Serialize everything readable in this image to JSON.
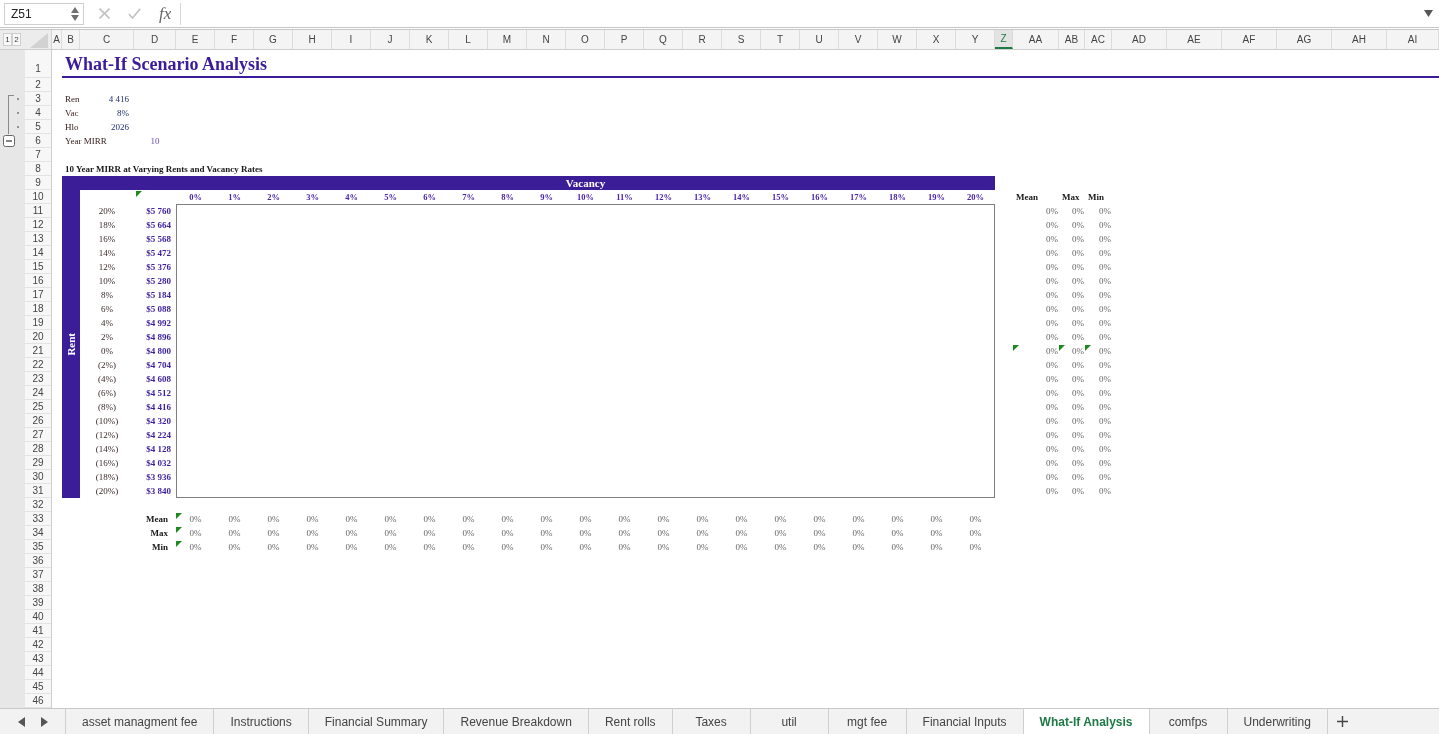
{
  "formula_bar": {
    "name_box": "Z51",
    "function_label": "fx"
  },
  "outline": {
    "levels": [
      "1",
      "2"
    ],
    "group_expanded": true
  },
  "columns": [
    {
      "label": "A",
      "selected": false
    },
    {
      "label": "B",
      "selected": false
    },
    {
      "label": "C",
      "selected": false
    },
    {
      "label": "D",
      "selected": false
    },
    {
      "label": "E",
      "selected": false
    },
    {
      "label": "F",
      "selected": false
    },
    {
      "label": "G",
      "selected": false
    },
    {
      "label": "H",
      "selected": false
    },
    {
      "label": "I",
      "selected": false
    },
    {
      "label": "J",
      "selected": false
    },
    {
      "label": "K",
      "selected": false
    },
    {
      "label": "L",
      "selected": false
    },
    {
      "label": "M",
      "selected": false
    },
    {
      "label": "N",
      "selected": false
    },
    {
      "label": "O",
      "selected": false
    },
    {
      "label": "P",
      "selected": false
    },
    {
      "label": "Q",
      "selected": false
    },
    {
      "label": "R",
      "selected": false
    },
    {
      "label": "S",
      "selected": false
    },
    {
      "label": "T",
      "selected": false
    },
    {
      "label": "U",
      "selected": false
    },
    {
      "label": "V",
      "selected": false
    },
    {
      "label": "W",
      "selected": false
    },
    {
      "label": "X",
      "selected": false
    },
    {
      "label": "Y",
      "selected": false
    },
    {
      "label": "Z",
      "selected": true
    },
    {
      "label": "AA",
      "selected": false
    },
    {
      "label": "AB",
      "selected": false
    },
    {
      "label": "AC",
      "selected": false
    },
    {
      "label": "AD",
      "selected": false
    },
    {
      "label": "AE",
      "selected": false
    },
    {
      "label": "AF",
      "selected": false
    },
    {
      "label": "AG",
      "selected": false
    },
    {
      "label": "AH",
      "selected": false
    },
    {
      "label": "AI",
      "selected": false
    }
  ],
  "row_numbers": [
    "1",
    "2",
    "3",
    "4",
    "5",
    "6",
    "7",
    "8",
    "9",
    "10",
    "11",
    "12",
    "13",
    "14",
    "15",
    "16",
    "17",
    "18",
    "19",
    "20",
    "21",
    "22",
    "23",
    "24",
    "25",
    "26",
    "27",
    "28",
    "29",
    "30",
    "31",
    "32",
    "33",
    "34",
    "35",
    "36",
    "37",
    "38",
    "39",
    "40",
    "41",
    "42",
    "43",
    "44",
    "45",
    "46"
  ],
  "sheet": {
    "title": "What-If Scenario Analysis",
    "inputs": [
      {
        "kind": "value",
        "label": "Ren",
        "value": "4 416"
      },
      {
        "kind": "value",
        "label": "Vac",
        "value": "8%"
      },
      {
        "kind": "value",
        "label": "Hlo",
        "value": "2026"
      },
      {
        "kind": "parameter",
        "label": "Year MIRR",
        "value": "10"
      }
    ],
    "table_title": "10 Year MIRR at Varying Rents and Vacancy Rates",
    "vacancy_label": "Vacancy",
    "rent_label": "Rent",
    "rent_header_flagged": true,
    "vacancy_rates": [
      "0%",
      "1%",
      "2%",
      "3%",
      "4%",
      "5%",
      "6%",
      "7%",
      "8%",
      "9%",
      "10%",
      "11%",
      "12%",
      "13%",
      "14%",
      "15%",
      "16%",
      "17%",
      "18%",
      "19%",
      "20%"
    ],
    "row_summary_headers": [
      "Mean",
      "Max",
      "Min"
    ],
    "rent_rows": [
      {
        "change": "20%",
        "rent": "$5 760",
        "summary": [
          "0%",
          "0%",
          "0%"
        ],
        "flagged": false
      },
      {
        "change": "18%",
        "rent": "$5 664",
        "summary": [
          "0%",
          "0%",
          "0%"
        ],
        "flagged": false
      },
      {
        "change": "16%",
        "rent": "$5 568",
        "summary": [
          "0%",
          "0%",
          "0%"
        ],
        "flagged": false
      },
      {
        "change": "14%",
        "rent": "$5 472",
        "summary": [
          "0%",
          "0%",
          "0%"
        ],
        "flagged": false
      },
      {
        "change": "12%",
        "rent": "$5 376",
        "summary": [
          "0%",
          "0%",
          "0%"
        ],
        "flagged": false
      },
      {
        "change": "10%",
        "rent": "$5 280",
        "summary": [
          "0%",
          "0%",
          "0%"
        ],
        "flagged": false
      },
      {
        "change": "8%",
        "rent": "$5 184",
        "summary": [
          "0%",
          "0%",
          "0%"
        ],
        "flagged": false
      },
      {
        "change": "6%",
        "rent": "$5 088",
        "summary": [
          "0%",
          "0%",
          "0%"
        ],
        "flagged": false
      },
      {
        "change": "4%",
        "rent": "$4 992",
        "summary": [
          "0%",
          "0%",
          "0%"
        ],
        "flagged": false
      },
      {
        "change": "2%",
        "rent": "$4 896",
        "summary": [
          "0%",
          "0%",
          "0%"
        ],
        "flagged": false
      },
      {
        "change": "0%",
        "rent": "$4 800",
        "summary": [
          "0%",
          "0%",
          "0%"
        ],
        "flagged": true
      },
      {
        "change": "(2%)",
        "rent": "$4 704",
        "summary": [
          "0%",
          "0%",
          "0%"
        ],
        "flagged": false
      },
      {
        "change": "(4%)",
        "rent": "$4 608",
        "summary": [
          "0%",
          "0%",
          "0%"
        ],
        "flagged": false
      },
      {
        "change": "(6%)",
        "rent": "$4 512",
        "summary": [
          "0%",
          "0%",
          "0%"
        ],
        "flagged": false
      },
      {
        "change": "(8%)",
        "rent": "$4 416",
        "summary": [
          "0%",
          "0%",
          "0%"
        ],
        "flagged": false
      },
      {
        "change": "(10%)",
        "rent": "$4 320",
        "summary": [
          "0%",
          "0%",
          "0%"
        ],
        "flagged": false
      },
      {
        "change": "(12%)",
        "rent": "$4 224",
        "summary": [
          "0%",
          "0%",
          "0%"
        ],
        "flagged": false
      },
      {
        "change": "(14%)",
        "rent": "$4 128",
        "summary": [
          "0%",
          "0%",
          "0%"
        ],
        "flagged": false
      },
      {
        "change": "(16%)",
        "rent": "$4 032",
        "summary": [
          "0%",
          "0%",
          "0%"
        ],
        "flagged": false
      },
      {
        "change": "(18%)",
        "rent": "$3 936",
        "summary": [
          "0%",
          "0%",
          "0%"
        ],
        "flagged": false
      },
      {
        "change": "(20%)",
        "rent": "$3 840",
        "summary": [
          "0%",
          "0%",
          "0%"
        ],
        "flagged": false
      }
    ],
    "column_summaries": [
      {
        "label": "Mean",
        "flagged": true,
        "values": [
          "0%",
          "0%",
          "0%",
          "0%",
          "0%",
          "0%",
          "0%",
          "0%",
          "0%",
          "0%",
          "0%",
          "0%",
          "0%",
          "0%",
          "0%",
          "0%",
          "0%",
          "0%",
          "0%",
          "0%",
          "0%"
        ]
      },
      {
        "label": "Max",
        "flagged": true,
        "values": [
          "0%",
          "0%",
          "0%",
          "0%",
          "0%",
          "0%",
          "0%",
          "0%",
          "0%",
          "0%",
          "0%",
          "0%",
          "0%",
          "0%",
          "0%",
          "0%",
          "0%",
          "0%",
          "0%",
          "0%",
          "0%"
        ]
      },
      {
        "label": "Min",
        "flagged": true,
        "values": [
          "0%",
          "0%",
          "0%",
          "0%",
          "0%",
          "0%",
          "0%",
          "0%",
          "0%",
          "0%",
          "0%",
          "0%",
          "0%",
          "0%",
          "0%",
          "0%",
          "0%",
          "0%",
          "0%",
          "0%",
          "0%"
        ]
      }
    ]
  },
  "sheet_tabs": [
    {
      "label": "asset managment fee",
      "selected": false
    },
    {
      "label": "Instructions",
      "selected": false
    },
    {
      "label": "Financial Summary",
      "selected": false
    },
    {
      "label": "Revenue Breakdown",
      "selected": false
    },
    {
      "label": "Rent rolls",
      "selected": false
    },
    {
      "label": "Taxes",
      "selected": false
    },
    {
      "label": "util",
      "selected": false
    },
    {
      "label": "mgt fee",
      "selected": false
    },
    {
      "label": "Financial Inputs",
      "selected": false
    },
    {
      "label": "What-If Analysis",
      "selected": true
    },
    {
      "label": "comfps",
      "selected": false
    },
    {
      "label": "Underwriting",
      "selected": false
    }
  ]
}
